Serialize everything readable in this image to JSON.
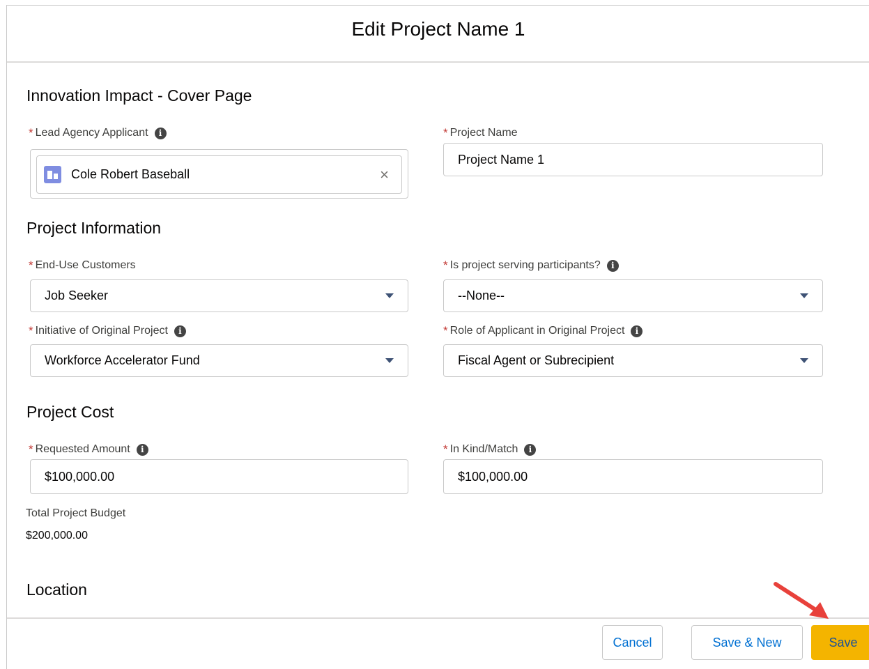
{
  "modal": {
    "title": "Edit Project Name 1"
  },
  "sections": {
    "cover": "Innovation Impact - Cover Page",
    "project_info": "Project Information",
    "project_cost": "Project Cost",
    "location": "Location"
  },
  "fields": {
    "lead_agency": {
      "label": "Lead Agency Applicant",
      "value": "Cole Robert Baseball",
      "clear": "×"
    },
    "project_name": {
      "label": "Project Name",
      "value": "Project Name 1"
    },
    "end_use": {
      "label": "End-Use Customers",
      "value": "Job Seeker"
    },
    "serving": {
      "label": "Is project serving participants?",
      "value": "--None--"
    },
    "initiative": {
      "label": "Initiative of Original Project",
      "value": "Workforce Accelerator Fund"
    },
    "role": {
      "label": "Role of Applicant in Original Project",
      "value": "Fiscal Agent or Subrecipient"
    },
    "requested": {
      "label": "Requested Amount",
      "value": "$100,000.00"
    },
    "in_kind": {
      "label": "In Kind/Match",
      "value": "$100,000.00"
    },
    "total": {
      "label": "Total Project Budget",
      "value": "$200,000.00"
    }
  },
  "required_marker": "*",
  "info_glyph": "i",
  "footer": {
    "cancel": "Cancel",
    "save_new": "Save & New",
    "save": "Save"
  },
  "colors": {
    "save_button": "#f4b400",
    "required": "#c23934",
    "annotation_arrow": "#e8413b"
  },
  "icons": {
    "lookup": "account-icon",
    "info": "info-icon",
    "clear": "close-icon",
    "select": "chevron-down-icon"
  }
}
